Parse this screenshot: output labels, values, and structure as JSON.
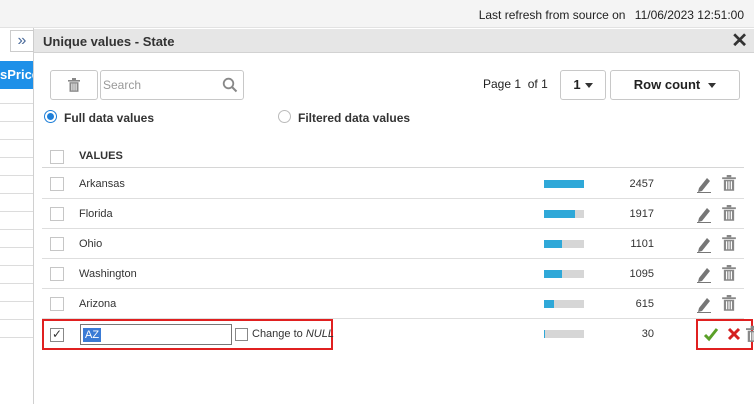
{
  "topbar": {
    "refresh_label": "Last refresh from source on",
    "refresh_time": "11/06/2023 12:51:00"
  },
  "left_panel": {
    "expand_icon": "double-chevron-right-icon",
    "column_header": "sPrice"
  },
  "dialog": {
    "title": "Unique values - State",
    "close_icon": "close-icon"
  },
  "toolbar": {
    "delete_icon": "trash-icon",
    "search_placeholder": "Search",
    "search_value": "",
    "search_icon": "search-icon",
    "page_label": "Page",
    "page_current": "1",
    "page_of": "of",
    "page_total": "1",
    "page_button": "1",
    "row_count_label": "Row count"
  },
  "options": {
    "full_label": "Full data values",
    "filtered_label": "Filtered data values",
    "selected": "full"
  },
  "table": {
    "header": "VALUES",
    "rows": [
      {
        "value": "Arkansas",
        "count": "2457",
        "fraction": 1.0
      },
      {
        "value": "Florida",
        "count": "1917",
        "fraction": 0.78
      },
      {
        "value": "Ohio",
        "count": "1101",
        "fraction": 0.45
      },
      {
        "value": "Washington",
        "count": "1095",
        "fraction": 0.45
      },
      {
        "value": "Arizona",
        "count": "615",
        "fraction": 0.25
      }
    ],
    "edit_row": {
      "value": "AZ",
      "count": "30",
      "fraction": 0.012,
      "checked": true,
      "change_to_label": "Change to",
      "null_label": "NULL"
    }
  },
  "icons": {
    "edit": "pencil-icon",
    "delete": "trash-icon",
    "confirm": "checkmark-icon",
    "cancel": "x-icon"
  },
  "colors": {
    "accent": "#1e90e8",
    "bar_fill": "#2fa8d8",
    "bar_bg": "#d6d6d6",
    "highlight_border": "#e02020",
    "confirm": "#5aa028",
    "cancel": "#d42020"
  }
}
